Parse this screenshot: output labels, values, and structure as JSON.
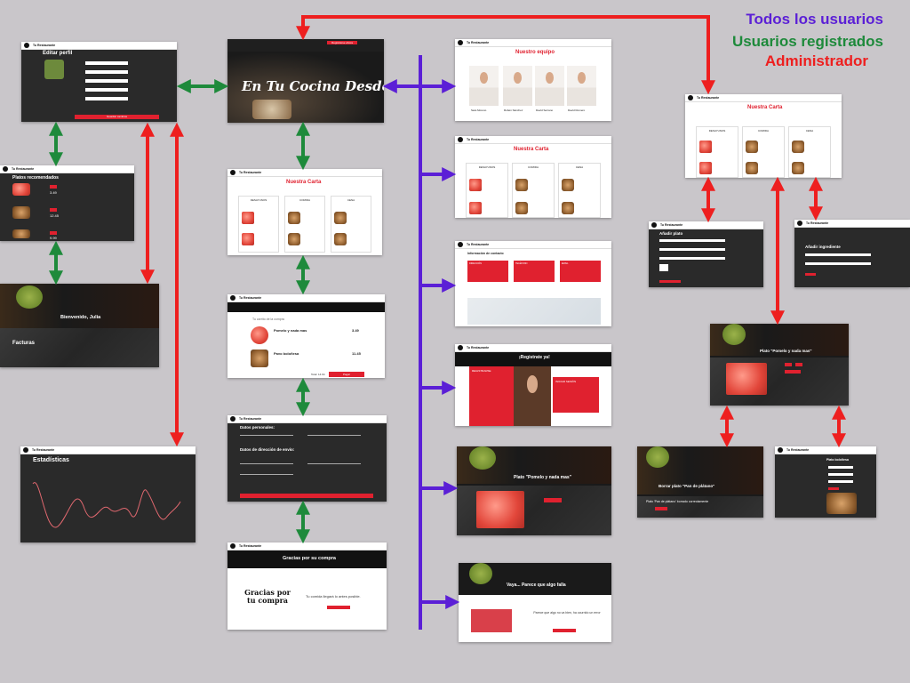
{
  "legend": {
    "all_users": "Todos los usuarios",
    "registered_users": "Usuarios registrados",
    "admin": "Administrador",
    "colors": {
      "all_users": "#5b1fd6",
      "registered_users": "#1e8a3b",
      "admin": "#ee1f1f"
    }
  },
  "brand": "Tu Restaurante",
  "nav_links": [
    "INICIO",
    "EQUIPO",
    "CARTA",
    "CONTACTO"
  ],
  "screens": {
    "edit_profile": {
      "title": "Editar perfil",
      "button": "Guardar cambios"
    },
    "recommended": {
      "title": "Platos recomendados",
      "prices": [
        "3.49",
        "12.45",
        "9.99"
      ]
    },
    "welcome": {
      "title": "Bienvenido, Julia",
      "section": "Facturas"
    },
    "stats": {
      "title": "Estadísticas"
    },
    "home": {
      "headline": "En Tu Cocina Desde",
      "cta": "Registrarse ahora"
    },
    "menu_main": {
      "title": "Nuestra Carta",
      "columns": [
        "DESAYUNOS",
        "COMIDA",
        "CENA"
      ]
    },
    "cart": {
      "header": "Tu carrito de la compra",
      "items": [
        {
          "name": "Pomelo y nada mas",
          "price": "3.49"
        },
        {
          "name": "Pavo boloñesa",
          "price": "11.45"
        }
      ],
      "total": "Total: 14.94",
      "pay": "Pagar"
    },
    "checkout": {
      "personal": "Datos personales:",
      "address": "Datos de dirección de envío:"
    },
    "thanks": {
      "title": "Gracias por su compra",
      "art": "Gracias por tu compra",
      "message": "Tu comida llegará lo antes posible."
    },
    "team": {
      "title": "Nuestro equipo",
      "members": [
        "Sara Moreno",
        "Rubén Sánchez",
        "David Serrano",
        "David Romero"
      ]
    },
    "menu_public": {
      "title": "Nuestra Carta",
      "columns": [
        "DESAYUNOS",
        "COMIDA",
        "CENA"
      ]
    },
    "contact": {
      "title": "Información de contacto",
      "boxes": [
        "DIRECCIÓN",
        "TELÉFONO",
        "EMAIL"
      ]
    },
    "register": {
      "title": "¡Registrate ya!",
      "left": "REGISTRARSE",
      "right": "INICIAR SESIÓN"
    },
    "dish": {
      "title": "Plato \"Pomelo y nada mas\""
    },
    "error": {
      "title": "Vaya... Parece que algo falla",
      "message": "Parece que algo no va bien, ha ocurrido un error"
    },
    "admin_menu": {
      "title": "Nuestra Carta",
      "columns": [
        "DESAYUNOS",
        "COMIDA",
        "CENA"
      ]
    },
    "add_dish": {
      "title": "Añadir plato"
    },
    "add_ingredient": {
      "title": "Añadir ingrediente"
    },
    "admin_dish": {
      "title": "Plato \"Pomelo y nada mas\""
    },
    "delete_dish": {
      "title": "Borrar plato \"Pan de plátano\"",
      "message": "Plato 'Pan de plátano' borrado correctamente"
    },
    "edit_dish": {
      "title": "Plato boloñesa"
    }
  }
}
